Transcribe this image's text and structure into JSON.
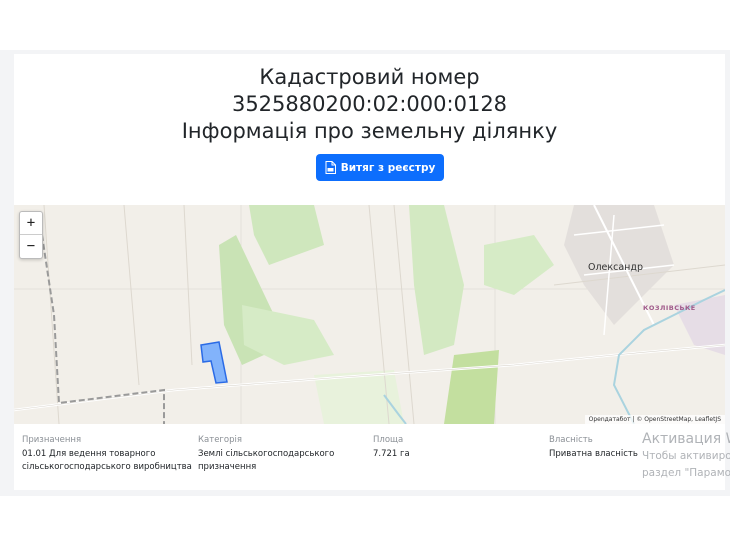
{
  "header": {
    "line1": "Кадастровий номер",
    "line2": "3525880200:02:000:0128",
    "line3": "Інформація про земельну ділянку"
  },
  "extract_button": {
    "label": "Витяг з реєстру",
    "icon": "pdf-document-icon"
  },
  "map": {
    "zoom_in": "+",
    "zoom_out": "−",
    "village_label": "Олександр",
    "district_label": "КОЗЛІВСЬКЕ",
    "attribution": "Openдатабот | © OpenStreetMap, LeafletJS",
    "parcel_color": "#6ea8fe"
  },
  "info": [
    {
      "label": "Призначення",
      "value_lines": [
        "01.01 Для ведення товарного",
        "сільськогосподарського виробництва"
      ]
    },
    {
      "label": "Категорія",
      "value_lines": [
        "Землі сільськогосподарського",
        "призначення"
      ]
    },
    {
      "label": "Площа",
      "value_lines": [
        "7.721 га"
      ]
    },
    {
      "label": "Власність",
      "value_lines": [
        "Приватна власність"
      ]
    }
  ],
  "activation": {
    "line1": "Активация W",
    "line2": "Чтобы активиро",
    "line3": "раздел \"Парамо"
  }
}
